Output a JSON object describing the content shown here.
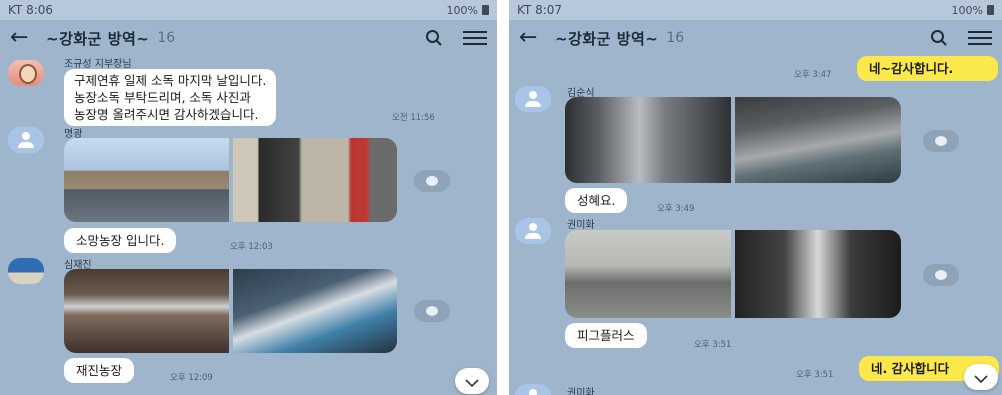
{
  "left": {
    "status": {
      "carrier_time": "KT 8:06",
      "right": "100%"
    },
    "header": {
      "title": "~강화군 방역~",
      "count": "16"
    },
    "messages": {
      "m1": {
        "sender": "조규성 지부장님",
        "lines": [
          "구제연휴 일제 소독 마지막 날입니다.",
          "농장소독 부탁드리며, 소독 사진과",
          "농장명 올려주시면 감사하겠습니다."
        ],
        "time": "오전 11:56"
      },
      "m2": {
        "sender": "명광",
        "text": "소망농장 입니다.",
        "time": "오후 12:03"
      },
      "m3": {
        "sender": "심재진",
        "text": "재진농장",
        "time": "오후 12:09"
      }
    }
  },
  "right": {
    "status": {
      "carrier_time": "KT 8:07",
      "right": "100%"
    },
    "header": {
      "title": "~강화군 방역~",
      "count": "16"
    },
    "messages": {
      "r0": {
        "text": "네~감사합니다.",
        "time": "오후 3:47"
      },
      "r1": {
        "sender": "김순식",
        "text": "성혜요.",
        "time": "오후 3:49"
      },
      "r2": {
        "sender": "권미화",
        "text": "피그플러스",
        "time": "오후 3:51"
      },
      "r3": {
        "text": "네. 감사합니다",
        "time": "오후 3:51"
      },
      "r4": {
        "sender": "권미화"
      }
    }
  },
  "icons": {
    "back": "back-arrow-icon",
    "search": "search-icon",
    "menu": "menu-icon",
    "share": "share-icon",
    "scroll": "chevron-down-icon"
  },
  "colors": {
    "background": "#9fb5cb",
    "my_bubble": "#fbe84a",
    "other_bubble": "#ffffff"
  }
}
